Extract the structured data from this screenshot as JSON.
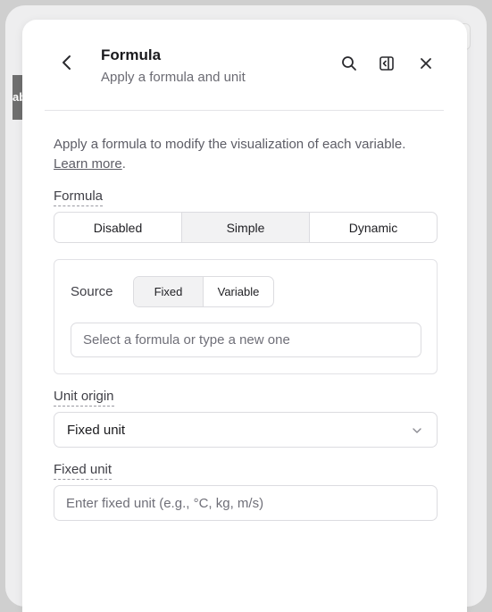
{
  "background": {
    "tab_text": "ab"
  },
  "header": {
    "title": "Formula",
    "subtitle": "Apply a formula and unit"
  },
  "intro": {
    "text": "Apply a formula to modify the visualization of each variable. ",
    "link": "Learn more",
    "suffix": "."
  },
  "formula": {
    "label": "Formula",
    "options": [
      "Disabled",
      "Simple",
      "Dynamic"
    ],
    "selected": "Simple"
  },
  "source": {
    "label": "Source",
    "options": [
      "Fixed",
      "Variable"
    ],
    "selected": "Fixed",
    "input_placeholder": "Select a formula or type a new one",
    "input_value": ""
  },
  "unit_origin": {
    "label": "Unit origin",
    "selected_value": "Fixed unit"
  },
  "fixed_unit": {
    "label": "Fixed unit",
    "placeholder": "Enter fixed unit (e.g., °C, kg, m/s)",
    "value": ""
  },
  "colors": {
    "accent_text": "#1f1f23",
    "muted_text": "#6b6b73",
    "border": "#dcdce0",
    "active_segment": "#f2f2f3"
  }
}
